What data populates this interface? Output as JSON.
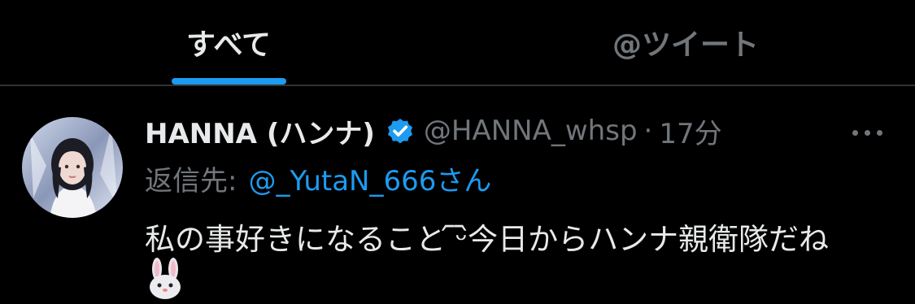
{
  "tabs": [
    {
      "label": "すべて",
      "active": true
    },
    {
      "label": "@ツイート",
      "active": false
    }
  ],
  "colors": {
    "accent": "#1d9bf0",
    "muted": "#71767b",
    "text": "#e7e9ea",
    "background": "#000000"
  },
  "tweet": {
    "author_name": "HANNA (ハンナ)",
    "verified_icon": "verified-badge-icon",
    "handle": "@HANNA_whsp",
    "separator": "·",
    "time": "17分",
    "more_icon": "more-options-icon",
    "reply_label": "返信先:",
    "reply_target": "@_YutaN_666さん",
    "text": "私の事好きになること ᷇ᵕ᷆今日からハンナ親衛隊だね",
    "emoji_icon": "rabbit-face-icon"
  }
}
